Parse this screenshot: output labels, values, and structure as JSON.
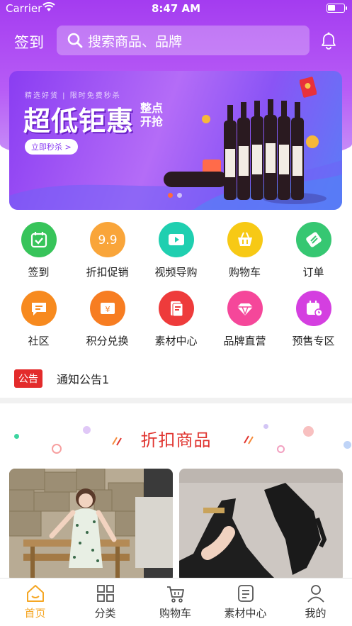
{
  "status_bar": {
    "carrier": "Carrier",
    "time": "8:47 AM"
  },
  "header": {
    "signin": "签到",
    "search_placeholder": "搜索商品、品牌"
  },
  "banner": {
    "tagline": "精选好货 | 限时免费秒杀",
    "title": "超低钜惠",
    "title_sub": "整点开抢",
    "cta": "立即秒杀 >"
  },
  "grid": [
    {
      "label": "签到",
      "icon": "calendar-check-icon",
      "color": "#37c45a"
    },
    {
      "label": "折扣促销",
      "icon": "discount-99-icon",
      "color": "#f9a53a"
    },
    {
      "label": "视频导购",
      "icon": "video-play-icon",
      "color": "#1fcfb0"
    },
    {
      "label": "购物车",
      "icon": "basket-icon",
      "color": "#f7c915"
    },
    {
      "label": "订单",
      "icon": "ticket-icon",
      "color": "#36c772"
    },
    {
      "label": "社区",
      "icon": "chat-bubble-icon",
      "color": "#f78a1f"
    },
    {
      "label": "积分兑换",
      "icon": "points-exchange-icon",
      "color": "#f77d22"
    },
    {
      "label": "素材中心",
      "icon": "material-doc-icon",
      "color": "#ee3b3b"
    },
    {
      "label": "品牌直营",
      "icon": "diamond-icon",
      "color": "#f5479a"
    },
    {
      "label": "预售专区",
      "icon": "presale-calendar-icon",
      "color": "#d43fe0"
    }
  ],
  "notice": {
    "badge": "公告",
    "text": "通知公告1"
  },
  "section": {
    "title": "折扣商品"
  },
  "tabs": [
    {
      "label": "首页",
      "icon": "home-icon",
      "active": true
    },
    {
      "label": "分类",
      "icon": "category-grid-icon",
      "active": false
    },
    {
      "label": "购物车",
      "icon": "cart-icon",
      "active": false
    },
    {
      "label": "素材中心",
      "icon": "material-doc-icon",
      "active": false
    },
    {
      "label": "我的",
      "icon": "profile-icon",
      "active": false
    }
  ],
  "colors": {
    "header_purple": "#a43cf0",
    "accent_red": "#e0342f",
    "tab_active": "#f5a623"
  }
}
